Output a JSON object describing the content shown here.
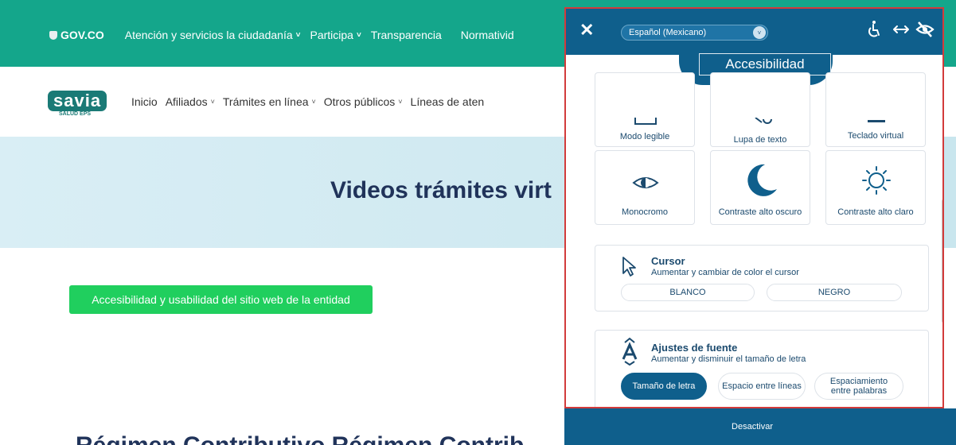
{
  "gov_bar": {
    "logo": "GOV.CO",
    "links": [
      "Atención y servicios la ciudadanía",
      "Participa",
      "Transparencia",
      "Normativid"
    ]
  },
  "site_nav": {
    "logo_text": "savia",
    "logo_sub": "SALUD EPS",
    "menu": [
      "Inicio",
      "Afiliados",
      "Trámites en línea",
      "Otros públicos",
      "Líneas de aten"
    ]
  },
  "hero": {
    "title": "Videos trámites virt"
  },
  "accessibility_link": "Accesibilidad y usabilidad del sitio web de la entidad",
  "bottom_heading": "Régimen Contributivo   Régimen Contrib",
  "panel": {
    "language": "Español (Mexicano)",
    "tab_title": "Accesibilidad",
    "tiles_row1": [
      "Modo legible",
      "Lupa de texto",
      "Teclado virtual"
    ],
    "tiles_row2": [
      "Monocromo",
      "Contraste alto oscuro",
      "Contraste alto claro"
    ],
    "cursor": {
      "title": "Cursor",
      "desc": "Aumentar y cambiar de color el cursor",
      "options": [
        "BLANCO",
        "NEGRO"
      ]
    },
    "font": {
      "title": "Ajustes de fuente",
      "desc": "Aumentar y disminuir el tamaño de letra",
      "options": [
        "Tamaño de letra",
        "Espacio entre líneas",
        "Espaciamiento entre palabras"
      ]
    },
    "deactivate": "Desactivar",
    "colors": {
      "header": "#0f5f8c",
      "border": "#d23b3b",
      "green": "#20cf5e",
      "teal": "#14a68b"
    }
  }
}
